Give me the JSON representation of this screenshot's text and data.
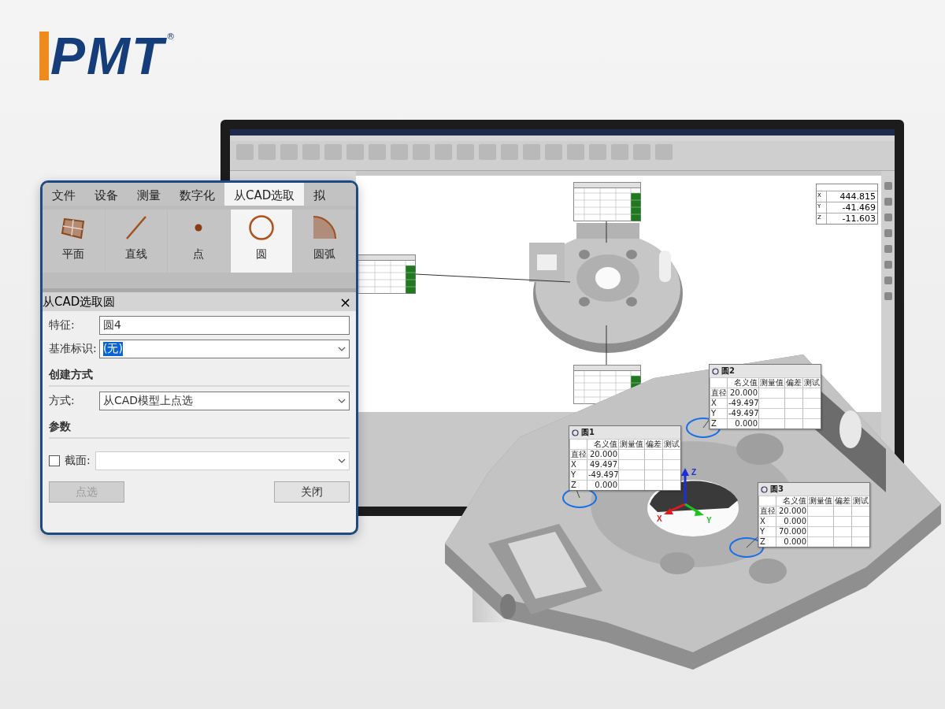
{
  "logo": {
    "text": "PMT",
    "mark": "®"
  },
  "monitor": {
    "readout": [
      {
        "axis": "X",
        "value": "444.815"
      },
      {
        "axis": "Y",
        "value": "-41.469"
      },
      {
        "axis": "Z",
        "value": "-11.603"
      }
    ]
  },
  "dialog": {
    "tabs": [
      {
        "label": "文件",
        "selected": false
      },
      {
        "label": "设备",
        "selected": false
      },
      {
        "label": "测量",
        "selected": false
      },
      {
        "label": "数字化",
        "selected": false
      },
      {
        "label": "从CAD选取",
        "selected": true
      },
      {
        "label": "拟",
        "selected": false
      }
    ],
    "tools": [
      {
        "label": "平面",
        "kind": "plane",
        "selected": false
      },
      {
        "label": "直线",
        "kind": "line",
        "selected": false
      },
      {
        "label": "点",
        "kind": "point",
        "selected": false
      },
      {
        "label": "圆",
        "kind": "circle",
        "selected": true
      },
      {
        "label": "圆弧",
        "kind": "arc",
        "selected": false
      }
    ],
    "panel": {
      "title": "从CAD选取圆",
      "close": "×",
      "feature": {
        "label": "特征:",
        "value": "圆4"
      },
      "datum": {
        "label": "基准标识:",
        "value": "(无)"
      },
      "section1": "创建方式",
      "method": {
        "label": "方式:",
        "value": "从CAD模型上点选"
      },
      "section2": "参数",
      "cut": {
        "label": "截面:",
        "checked": false
      },
      "buttons": [
        {
          "label": "点选",
          "disabled": true
        },
        {
          "label": "关闭",
          "disabled": false
        }
      ]
    }
  },
  "callouts": [
    {
      "title": "圆2",
      "columns": [
        "名义值",
        "测量值",
        "偏差",
        "测试"
      ],
      "rows": [
        {
          "label": "直径",
          "nominal": "20.000"
        },
        {
          "label": "X",
          "nominal": "-49.497"
        },
        {
          "label": "Y",
          "nominal": "-49.497"
        },
        {
          "label": "Z",
          "nominal": "0.000"
        }
      ]
    },
    {
      "title": "圆1",
      "columns": [
        "名义值",
        "测量值",
        "偏差",
        "测试"
      ],
      "rows": [
        {
          "label": "直径",
          "nominal": "20.000"
        },
        {
          "label": "X",
          "nominal": "49.497"
        },
        {
          "label": "Y",
          "nominal": "-49.497"
        },
        {
          "label": "Z",
          "nominal": "0.000"
        }
      ]
    },
    {
      "title": "圆3",
      "columns": [
        "名义值",
        "测量值",
        "偏差",
        "测试"
      ],
      "rows": [
        {
          "label": "直径",
          "nominal": "20.000"
        },
        {
          "label": "X",
          "nominal": "0.000"
        },
        {
          "label": "Y",
          "nominal": "70.000"
        },
        {
          "label": "Z",
          "nominal": "0.000"
        }
      ]
    }
  ],
  "triad": {
    "labels": [
      "X",
      "Y",
      "Z"
    ]
  }
}
